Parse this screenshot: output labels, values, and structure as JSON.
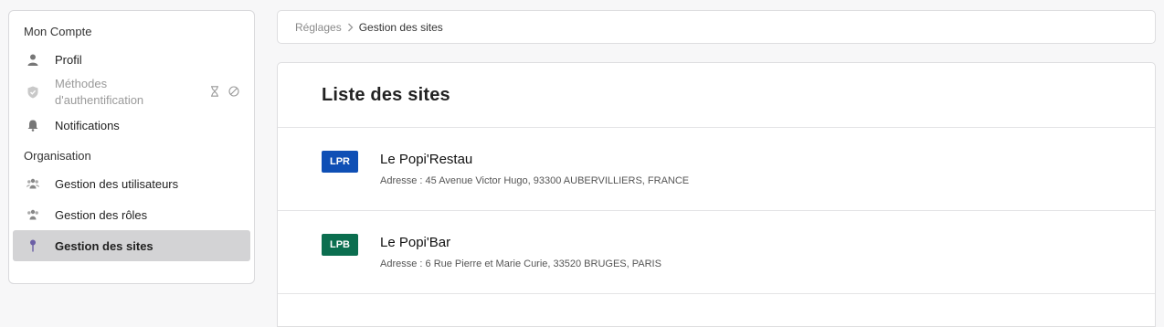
{
  "sidebar": {
    "account_title": "Mon Compte",
    "org_title": "Organisation",
    "items": [
      {
        "label": "Profil"
      },
      {
        "label": "Méthodes d'authentification"
      },
      {
        "label": "Notifications"
      },
      {
        "label": "Gestion des utilisateurs"
      },
      {
        "label": "Gestion des rôles"
      },
      {
        "label": "Gestion des sites"
      }
    ]
  },
  "breadcrumb": {
    "root": "Réglages",
    "current": "Gestion des sites"
  },
  "main": {
    "title": "Liste des sites",
    "sites": [
      {
        "code": "LPR",
        "name": "Le Popi'Restau",
        "address": "Adresse : 45 Avenue Victor Hugo, 93300 AUBERVILLIERS, FRANCE",
        "color": "#0f4fb5"
      },
      {
        "code": "LPB",
        "name": "Le Popi'Bar",
        "address": "Adresse : 6 Rue Pierre et Marie Curie, 33520 BRUGES, PARIS",
        "color": "#0b6e4f"
      }
    ]
  },
  "icons": [
    "person-icon",
    "shield-icon",
    "hourglass-icon",
    "forbidden-icon",
    "bell-icon",
    "users-icon",
    "roles-icon",
    "pin-icon",
    "chevron-right-icon"
  ]
}
